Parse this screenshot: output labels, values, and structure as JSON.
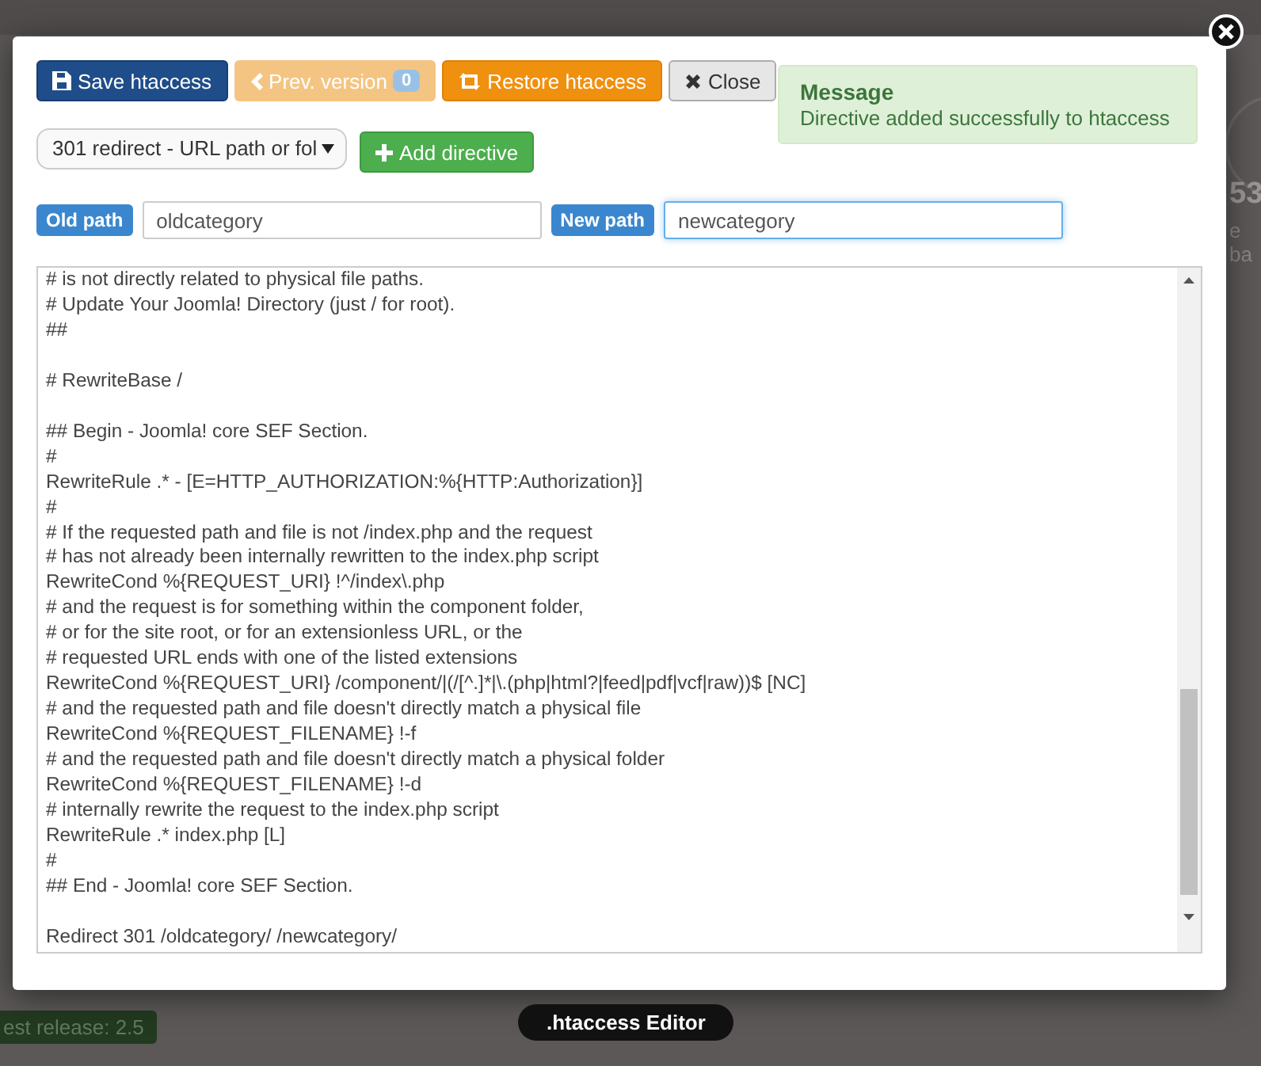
{
  "background": {
    "stat_number": "53",
    "stat_caption": "e ba",
    "release_badge": "est release: 2.5"
  },
  "toolbar": [
    {
      "kind": "save",
      "label": "Save htaccess",
      "disabled": false
    },
    {
      "kind": "prev",
      "label": "Prev. version",
      "disabled": true,
      "badge": "0"
    },
    {
      "kind": "restore",
      "label": "Restore htaccess",
      "disabled": false
    },
    {
      "kind": "close",
      "label": "Close",
      "disabled": false
    }
  ],
  "message": {
    "title": "Message",
    "text": "Directive added successfully to htaccess"
  },
  "directive_select": {
    "value": "301 redirect - URL path or fol"
  },
  "add_button": {
    "label": "Add directive"
  },
  "old_path": {
    "label": "Old path",
    "value": "oldcategory"
  },
  "new_path": {
    "label": "New path",
    "value": "newcategory",
    "focused": true
  },
  "editor": {
    "text": "# is not directly related to physical file paths.\n# Update Your Joomla! Directory (just / for root).\n##\n\n# RewriteBase /\n\n## Begin - Joomla! core SEF Section.\n#\nRewriteRule .* - [E=HTTP_AUTHORIZATION:%{HTTP:Authorization}]\n#\n# If the requested path and file is not /index.php and the request\n# has not already been internally rewritten to the index.php script\nRewriteCond %{REQUEST_URI} !^/index\\.php\n# and the request is for something within the component folder,\n# or for the site root, or for an extensionless URL, or the\n# requested URL ends with one of the listed extensions\nRewriteCond %{REQUEST_URI} /component/|(/[^.]*|\\.(php|html?|feed|pdf|vcf|raw))$ [NC]\n# and the requested path and file doesn't directly match a physical file\nRewriteCond %{REQUEST_FILENAME} !-f\n# and the requested path and file doesn't directly match a physical folder\nRewriteCond %{REQUEST_FILENAME} !-d\n# internally rewrite the request to the index.php script\nRewriteRule .* index.php [L]\n#\n## End - Joomla! core SEF Section.\n\nRedirect 301 /oldcategory/ /newcategory/"
  },
  "caption": ".htaccess Editor"
}
